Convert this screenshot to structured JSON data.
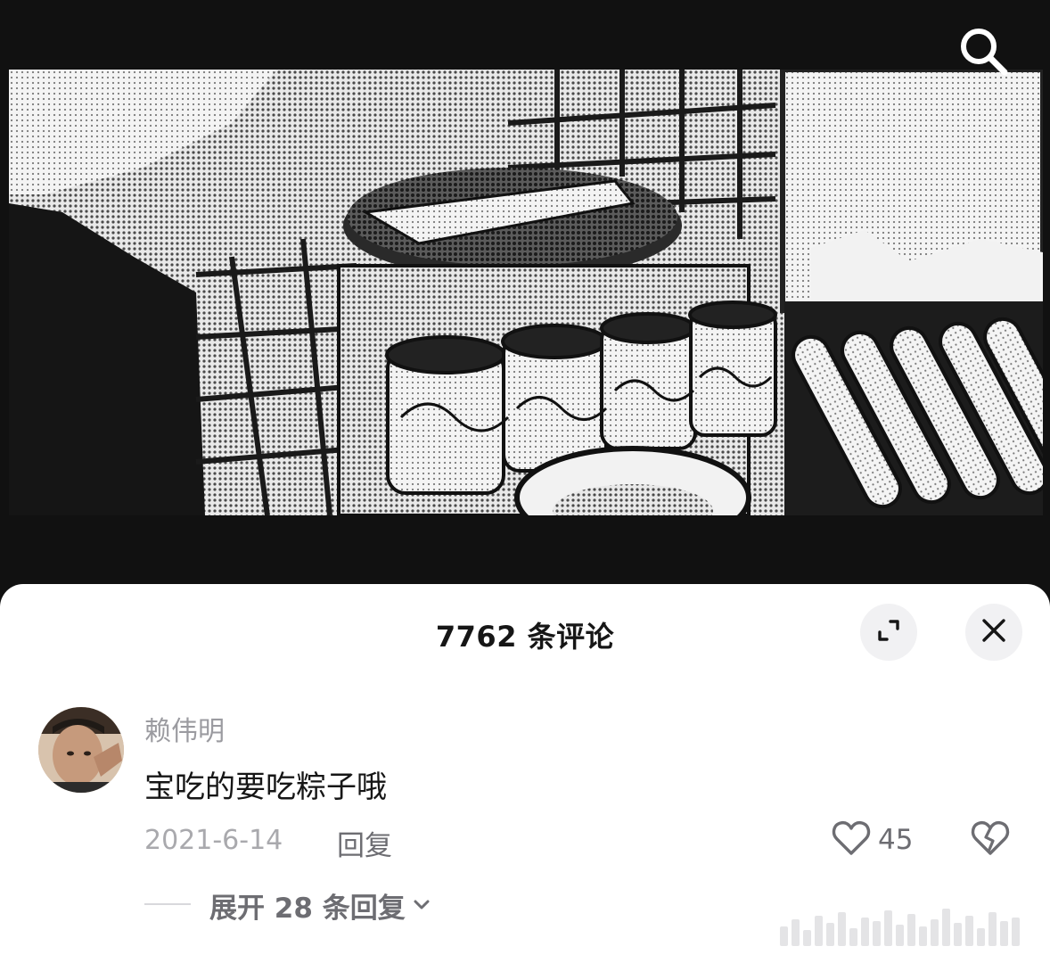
{
  "comments_panel": {
    "title": "7762 条评论",
    "comment": {
      "username": "赖伟明",
      "text": "宝吃的要吃粽子哦",
      "date": "2021-6-14",
      "reply_label": "回复",
      "like_count": "45"
    },
    "expand_replies_label": "展开 28 条回复"
  },
  "icons": {
    "search": "search-icon",
    "expand": "expand-icon",
    "close": "close-icon",
    "like": "heart-outline-icon",
    "dislike": "broken-heart-icon",
    "chevron": "chevron-down-icon"
  },
  "colors": {
    "sheet_background": "#ffffff",
    "video_background": "#111111",
    "muted_text": "#9b9ba0",
    "primary_text": "#161616"
  }
}
